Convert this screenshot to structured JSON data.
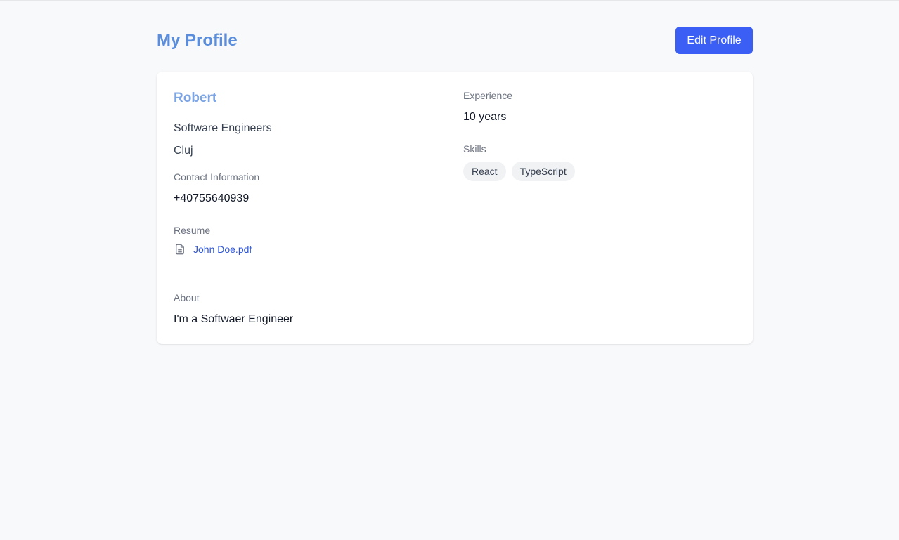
{
  "header": {
    "title": "My Profile",
    "edit_label": "Edit Profile"
  },
  "profile": {
    "name": "Robert",
    "role": "Software Engineers",
    "location": "Cluj",
    "contact_label": "Contact Information",
    "phone": "+40755640939",
    "resume_label": "Resume",
    "resume_file": "John Doe.pdf",
    "resume_icon": "file-text-icon",
    "about_label": "About",
    "about": "I'm a Softwaer Engineer",
    "experience_label": "Experience",
    "experience": "10 years",
    "skills_label": "Skills",
    "skills": [
      "React",
      "TypeScript"
    ]
  },
  "colors": {
    "accent": "#3b5ef5",
    "title": "#5a8edc",
    "name": "#7da4e3",
    "link": "#2f55d4",
    "background": "#f8f9fb"
  }
}
